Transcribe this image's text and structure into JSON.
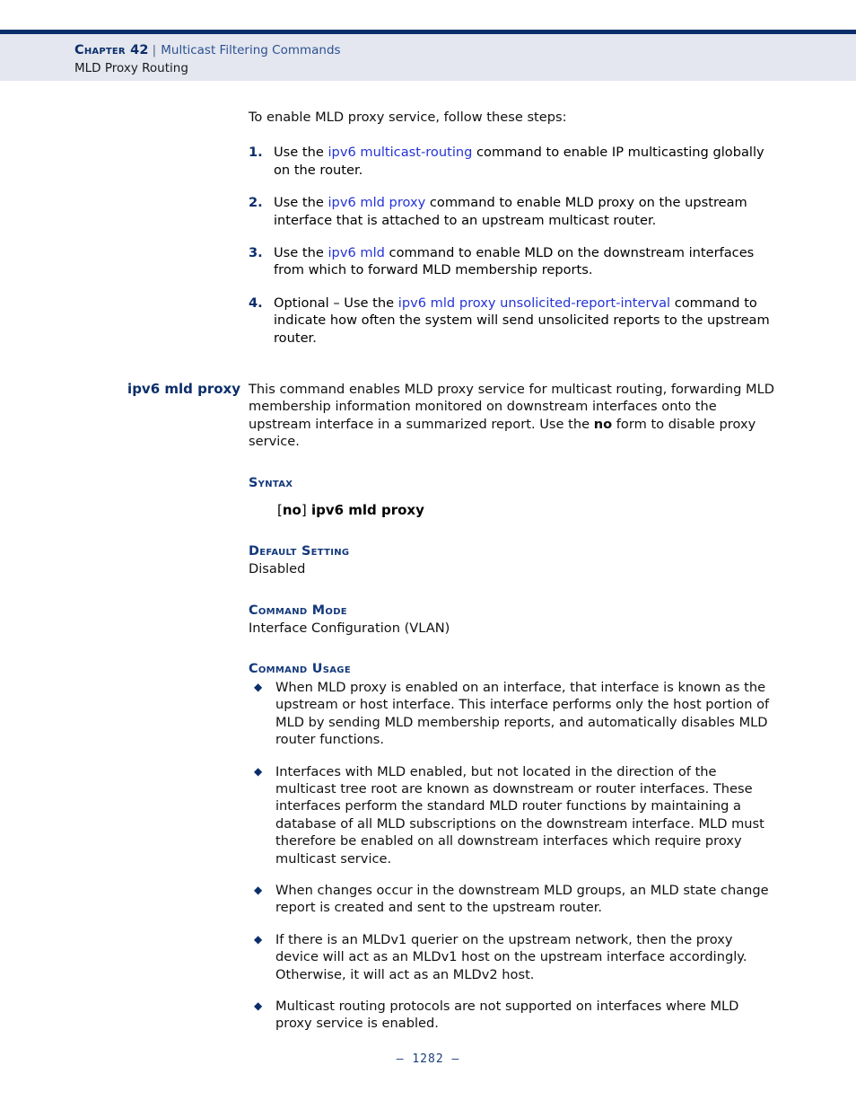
{
  "header": {
    "chapter": "Chapter 42",
    "separator": "|",
    "topic": "Multicast Filtering Commands",
    "subtitle": "MLD Proxy Routing"
  },
  "intro": {
    "text": "To enable MLD proxy service, follow these steps:"
  },
  "steps": [
    {
      "num": "1.",
      "pre": "Use the ",
      "link": "ipv6 multicast-routing",
      "post": " command to enable IP multicasting globally on the router."
    },
    {
      "num": "2.",
      "pre": "Use the ",
      "link": "ipv6 mld proxy",
      "post": " command to enable MLD proxy on the upstream interface that is attached to an upstream multicast router."
    },
    {
      "num": "3.",
      "pre": "Use the ",
      "link": "ipv6 mld",
      "post": " command to enable MLD on the downstream interfaces from which to forward MLD membership reports."
    },
    {
      "num": "4.",
      "pre": "Optional – Use the ",
      "link": "ipv6 mld proxy unsolicited-report-interval",
      "post": " command to indicate how often the system will send unsolicited reports to the upstream router."
    }
  ],
  "command": {
    "side_heading": "ipv6 mld proxy",
    "description_part1": "This command enables MLD proxy service for multicast routing, forwarding MLD membership information monitored on downstream interfaces onto the upstream interface in a summarized report. Use the ",
    "description_bold": "no",
    "description_part2": " form to disable proxy service.",
    "syntax_heading": "Syntax",
    "syntax_bracket_open": "[",
    "syntax_no": "no",
    "syntax_bracket_close": "]",
    "syntax_command": "ipv6 mld proxy",
    "default_setting_heading": "Default Setting",
    "default_setting_value": "Disabled",
    "command_mode_heading": "Command Mode",
    "command_mode_value": "Interface Configuration (VLAN)",
    "command_usage_heading": "Command Usage",
    "usage_bullets": [
      "When MLD proxy is enabled on an interface, that interface is known as the upstream or host interface. This interface performs only the host portion of MLD by sending MLD membership reports, and automatically disables MLD router functions.",
      "Interfaces with MLD enabled, but not located in the direction of the multicast tree root are known as downstream or router interfaces. These interfaces perform the standard MLD router functions by maintaining a database of all MLD subscriptions on the downstream interface. MLD must therefore be enabled on all downstream interfaces which require proxy multicast service.",
      "When changes occur in the downstream MLD groups, an MLD state change report is created and sent to the upstream router.",
      "If there is an MLDv1 querier on the upstream network, then the proxy device will act as an MLDv1 host on the upstream interface accordingly. Otherwise, it will act as an MLDv2 host.",
      "Multicast routing protocols are not supported on interfaces where MLD proxy service is enabled."
    ],
    "bullet_glyph": "◆"
  },
  "footer": {
    "page_number": "–  1282  –"
  },
  "colors": {
    "navy": "#0b2e6b",
    "header_band": "#e4e7ef",
    "link_blue": "#2433d6",
    "subhead_navy": "#13387b"
  }
}
